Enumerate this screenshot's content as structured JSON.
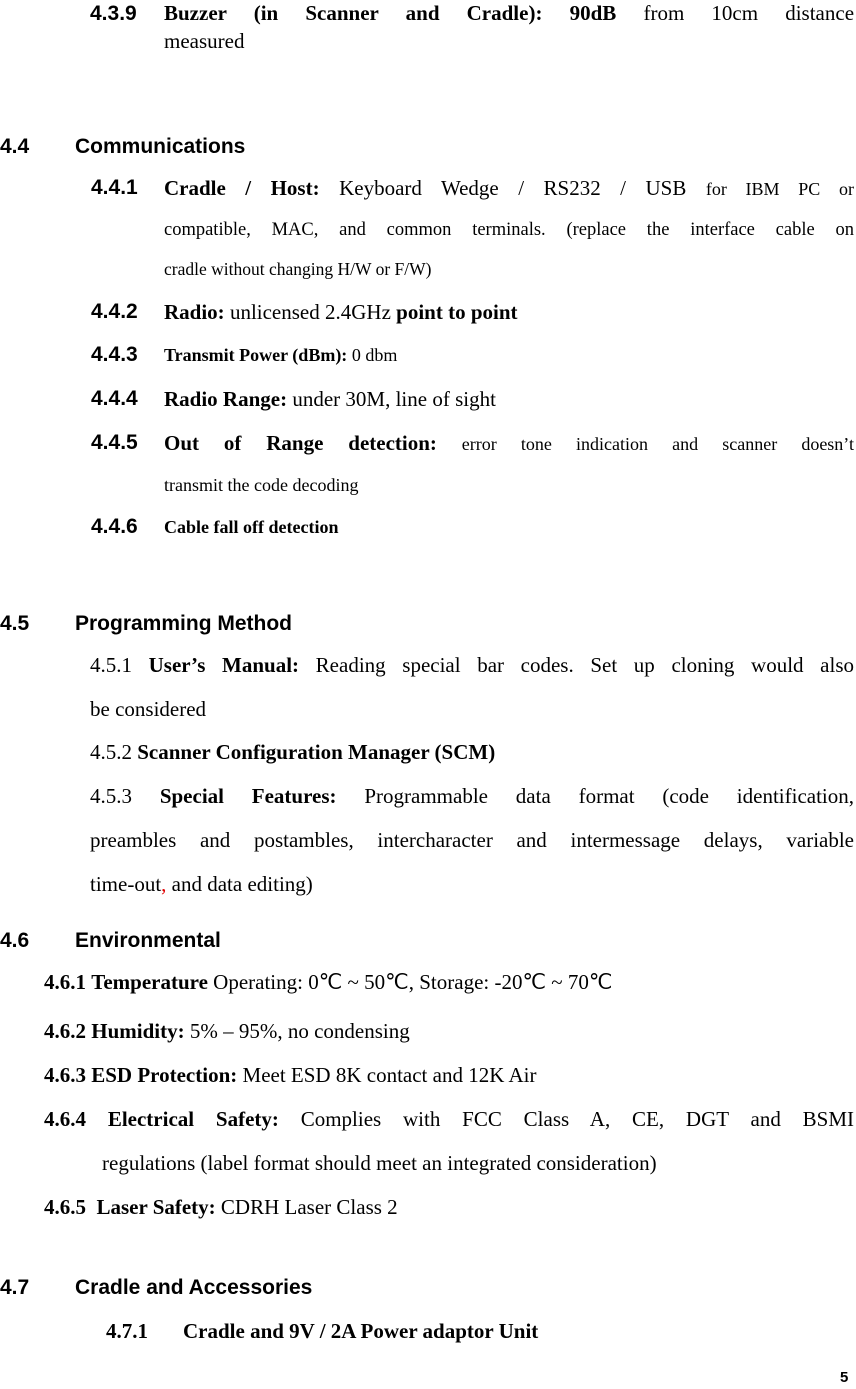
{
  "item_4_3_9": {
    "number": "4.3.9",
    "label": "Buzzer (in Scanner and Cradle): 90dB",
    "text_line1": "from 10cm distance",
    "text_line2": "measured"
  },
  "section_4_4": {
    "number": "4.4",
    "title": "Communications",
    "items": [
      {
        "number": "4.4.1",
        "label": "Cradle / Host:",
        "line1": "Keyboard Wedge / RS232 / USB",
        "line1_small": "for IBM PC or",
        "line2": "compatible, MAC, and common terminals. (replace the interface cable on",
        "line3": "cradle without changing H/W or F/W)"
      },
      {
        "number": "4.4.2",
        "label": "Radio:",
        "text": "unlicensed 2.4GHz",
        "bold_tail": "point to point"
      },
      {
        "number": "4.4.3",
        "label": "Transmit Power (dBm):",
        "text": "0 dbm"
      },
      {
        "number": "4.4.4",
        "label": "Radio Range:",
        "text": "under 30M, line of sight"
      },
      {
        "number": "4.4.5",
        "label": "Out of Range detection:",
        "line1": "error tone indication and scanner doesn’t",
        "line2": "transmit the code decoding"
      },
      {
        "number": "4.4.6",
        "label": "Cable fall off detection"
      }
    ]
  },
  "section_4_5": {
    "number": "4.5",
    "title": "Programming Method",
    "items": [
      {
        "number": "4.5.1",
        "label": "User’s Manual:",
        "line1": "Reading special bar codes. Set up cloning would also",
        "line2": "be considered"
      },
      {
        "number": "4.5.2",
        "label": "Scanner Configuration Manager (SCM)"
      },
      {
        "number": "4.5.3",
        "label": "Special Features:",
        "line1": "Programmable data format (code identification,",
        "line2": "preambles and postambles, intercharacter and intermessage delays, variable",
        "line3_a": "time-out",
        "line3_red": ",",
        "line3_b": " and data editing)"
      }
    ]
  },
  "section_4_6": {
    "number": "4.6",
    "title": "Environmental",
    "items": [
      {
        "number": "4.6.1",
        "label": "Temperature",
        "text": "Operating: 0℃ ~ 50℃, Storage: -20℃ ~ 70℃"
      },
      {
        "number": "4.6.2",
        "label": "Humidity:",
        "text": "5% – 95%, no condensing"
      },
      {
        "number": "4.6.3",
        "label": "ESD Protection:",
        "text": "Meet ESD 8K contact and 12K Air"
      },
      {
        "number": "4.6.4",
        "label": "Electrical Safety:",
        "line1": "Complies with FCC Class A, CE, DGT and BSMI",
        "line2": "regulations (label format should meet an integrated consideration)"
      },
      {
        "number": "4.6.5",
        "label": "Laser Safety:",
        "text": "CDRH Laser Class 2"
      }
    ]
  },
  "section_4_7": {
    "number": "4.7",
    "title": "Cradle and Accessories",
    "items": [
      {
        "number": "4.7.1",
        "label": "Cradle and 9V / 2A Power adaptor Unit"
      }
    ]
  },
  "page_number": "5",
  "colors": {
    "text": "#000000",
    "highlight_red": "#e00000"
  }
}
